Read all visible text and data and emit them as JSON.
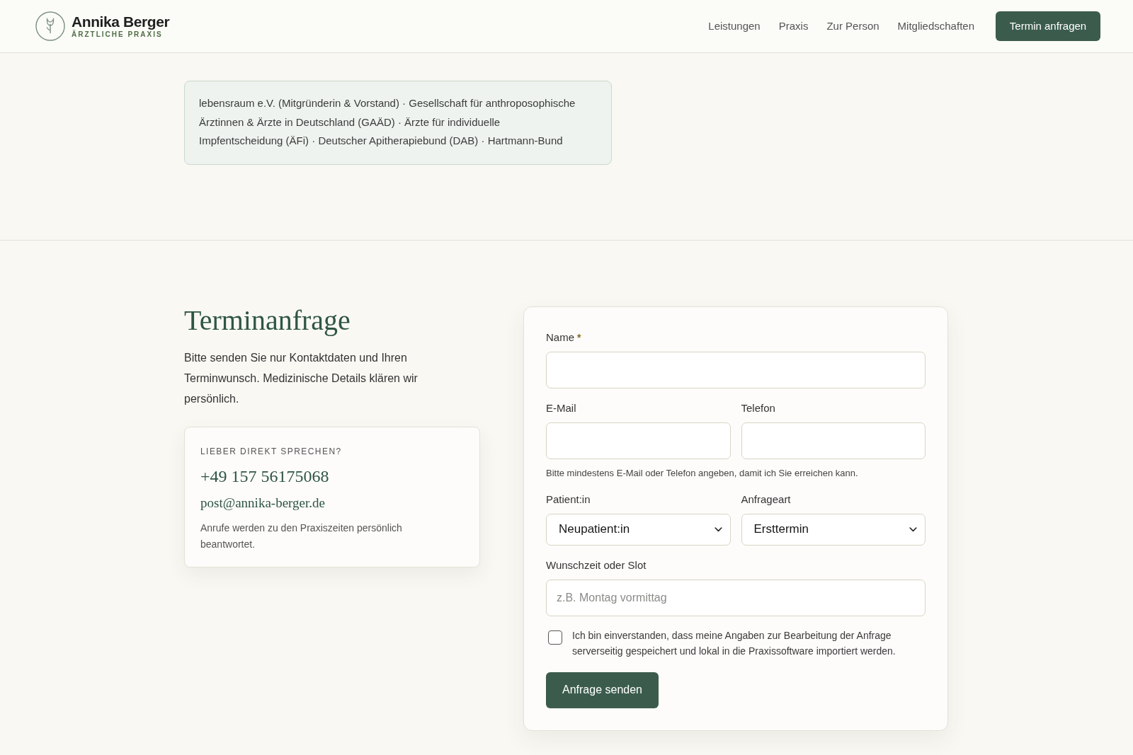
{
  "header": {
    "logo": {
      "name": "Annika Berger",
      "subtitle": "ÄRZTLICHE PRAXIS"
    },
    "nav": [
      {
        "label": "Leistungen"
      },
      {
        "label": "Praxis"
      },
      {
        "label": "Zur Person"
      },
      {
        "label": "Mitgliedschaften"
      }
    ],
    "cta": "Termin anfragen"
  },
  "memberships": {
    "text": "lebensraum e.V. (Mitgründerin & Vorstand) · Gesellschaft für anthroposophische Ärztinnen & Ärzte in Deutschland (GAÄD) · Ärzte für individuelle Impfentscheidung (ÄFi) · Deutscher Apitherapiebund (DAB) · Hartmann-Bund"
  },
  "appointment": {
    "title": "Terminanfrage",
    "intro": "Bitte senden Sie nur Kontaktdaten und Ihren Terminwunsch. Medizinische Details klären wir persönlich.",
    "contact_card": {
      "eyebrow": "LIEBER DIREKT SPRECHEN?",
      "phone": "+49 157 56175068",
      "email": "post@annika-berger.de",
      "note": "Anrufe werden zu den Praxiszeiten persönlich beantwortet."
    }
  },
  "form": {
    "rows": [
      {
        "fields": [
          {
            "kind": "text",
            "label": "Name",
            "required_mark": "*"
          }
        ]
      },
      {
        "fields": [
          {
            "kind": "text",
            "label": "E-Mail"
          },
          {
            "kind": "text",
            "label": "Telefon"
          }
        ],
        "hint": "Bitte mindestens E-Mail oder Telefon angeben, damit ich Sie erreichen kann."
      },
      {
        "fields": [
          {
            "kind": "select",
            "label": "Patient:in",
            "value": "Neupatient:in"
          },
          {
            "kind": "select",
            "label": "Anfrageart",
            "value": "Ersttermin"
          }
        ]
      },
      {
        "fields": [
          {
            "kind": "text",
            "label": "Wunschzeit oder Slot",
            "placeholder": "z.B. Montag vormittag"
          }
        ]
      }
    ],
    "consent": {
      "checked": false,
      "label": "Ich bin einverstanden, dass meine Angaben zur Bearbeitung der Anfrage serverseitig gespeichert und lokal in die Praxissoftware importiert werden."
    },
    "submit": "Anfrage senden"
  }
}
